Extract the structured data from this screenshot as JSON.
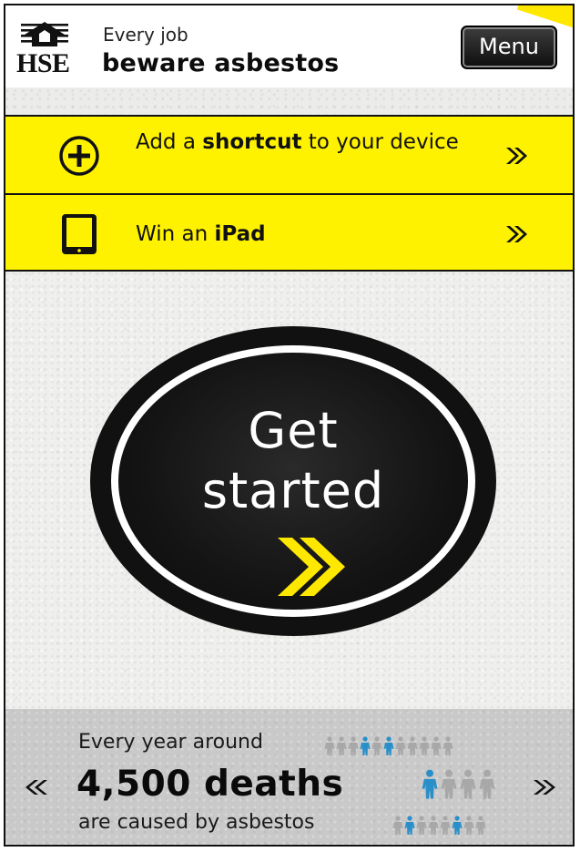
{
  "header": {
    "logo_text": "HSE",
    "tagline_small": "Every job",
    "tagline_big": "beware asbestos",
    "menu_label": "Menu"
  },
  "promos": [
    {
      "icon": "plus-circle-icon",
      "text_before": "Add a ",
      "text_bold": "shortcut",
      "text_after": " to your device"
    },
    {
      "icon": "tablet-icon",
      "text_before": "Win an ",
      "text_bold": "iPad",
      "text_after": ""
    }
  ],
  "cta": {
    "line1": "Get",
    "line2": "started"
  },
  "stats": {
    "line1": "Every year around",
    "line2": "4,500 deaths",
    "line3": "are caused by asbestos"
  },
  "colors": {
    "brand_yellow": "#fff200",
    "dark": "#111111",
    "people_blue": "#2a8fc8",
    "people_gray": "#a8a8a8"
  }
}
